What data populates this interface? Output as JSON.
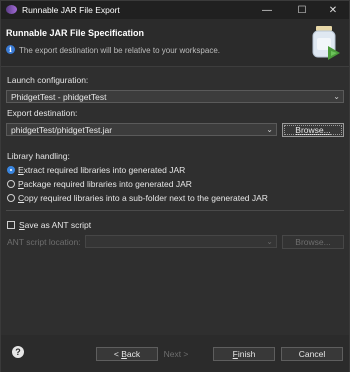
{
  "window": {
    "title": "Runnable JAR File Export"
  },
  "banner": {
    "heading": "Runnable JAR File Specification",
    "message": "The export destination will be relative to your workspace."
  },
  "launch": {
    "label": "Launch configuration:",
    "value": "PhidgetTest - phidgetTest"
  },
  "export": {
    "label": "Export destination:",
    "value": "phidgetTest/phidgetTest.jar",
    "browse": "Browse..."
  },
  "libraries": {
    "label": "Library handling:",
    "options": [
      {
        "first": "E",
        "rest": "xtract required libraries into generated JAR",
        "checked": true
      },
      {
        "first": "P",
        "rest": "ackage required libraries into generated JAR",
        "checked": false
      },
      {
        "first": "C",
        "rest": "opy required libraries into a sub-folder next to the generated JAR",
        "checked": false
      }
    ]
  },
  "ant": {
    "checkbox_first": "S",
    "checkbox_rest": "ave as ANT script",
    "location_label": "ANT script location:",
    "location_value": "",
    "browse": "Browse..."
  },
  "buttons": {
    "back_prefix": "< ",
    "back_u": "B",
    "back_rest": "ack",
    "next": "Next >",
    "finish_u": "F",
    "finish_rest": "inish",
    "cancel": "Cancel"
  }
}
